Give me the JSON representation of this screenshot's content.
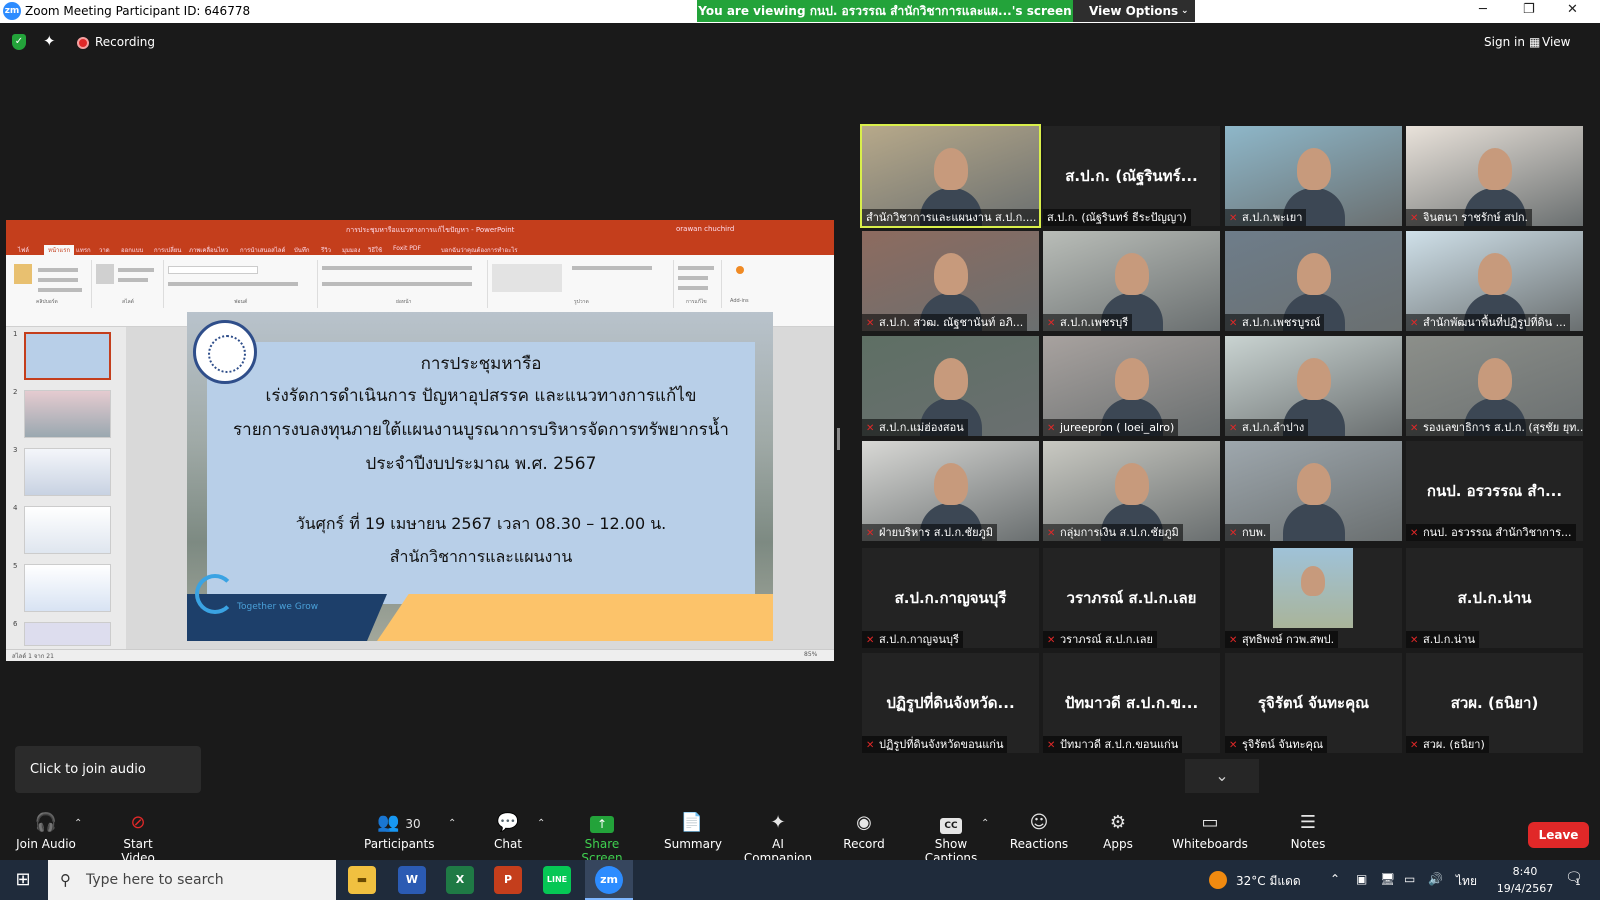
{
  "window": {
    "title": "Zoom Meeting Participant ID: 646778",
    "controls": [
      "─",
      "❐",
      "✕"
    ]
  },
  "share_banner": {
    "text": "You are viewing กนป. อรวรรณ สำนักวิชาการและแผ...'s screen",
    "button": "View Options"
  },
  "top_bar": {
    "recording": "Recording",
    "sign_in": "Sign in",
    "view": "View"
  },
  "shared_screen": {
    "app_title": "การประชุมหารือแนวทางการแก้ไขปัญหา - PowerPoint",
    "user": "orawan chuchird",
    "ribbon_tabs": [
      "ไฟล์",
      "หน้าแรก",
      "แทรก",
      "วาด",
      "ออกแบบ",
      "การเปลี่ยน",
      "ภาพเคลื่อนไหว",
      "การนำเสนอสไลด์",
      "บันทึก",
      "รีวิว",
      "มุมมอง",
      "วิธีใช้",
      "Foxit PDF",
      "บอกฉันว่าคุณต้องการทำอะไร"
    ],
    "ribbon_groups": [
      "คลิปบอร์ด",
      "สไลด์",
      "ฟอนต์",
      "ย่อหน้า",
      "รูปวาด",
      "การแก้ไข",
      "Add-ins"
    ],
    "thumb_numbers": [
      "1",
      "2",
      "3",
      "4",
      "5",
      "6"
    ],
    "slide": {
      "line1": "การประชุมหารือ",
      "line2": "เร่งรัดการดำเนินการ ปัญหาอุปสรรค และแนวทางการแก้ไข",
      "line3": "รายการงบลงทุนภายใต้แผนงานบูรณาการบริหารจัดการทรัพยากรน้ำ",
      "line4": "ประจำปีงบประมาณ พ.ศ. 2567",
      "line5": "วันศุกร์ ที่ 19 เมษายน  2567  เวลา 08.30 – 12.00 น.",
      "line6": "สำนักวิชาการและแผนงาน",
      "slogan": "Together we Grow"
    },
    "status_left": "สไลด์ 1 จาก 21",
    "status_zoom": "85%"
  },
  "gallery": [
    {
      "name": "สำนักวิชาการและแผนงาน ส.ป.ก....",
      "kind": "video",
      "active": true,
      "muted": false,
      "tone": "#b7a98a"
    },
    {
      "name": "ส.ป.ก. (ณัฐรินทร์ ธีระปัญญา)",
      "big": "ส.ป.ก. (ณัฐรินทร์...",
      "kind": "avatar",
      "muted": false
    },
    {
      "name": "ส.ป.ก.พะเยา",
      "kind": "video",
      "muted": true,
      "tone": "#8eb7c9"
    },
    {
      "name": "จินตนา  ราชรักษ์ สปก.",
      "kind": "video",
      "muted": true,
      "tone": "#e9e2da"
    },
    {
      "name": "ส.ป.ก. สวฒ. ณัฐชานันท์ อภิ...",
      "kind": "video",
      "muted": true,
      "tone": "#8d6b5f"
    },
    {
      "name": "ส.ป.ก.เพชรบุรี",
      "kind": "video",
      "muted": true,
      "tone": "#b9bdb8"
    },
    {
      "name": "ส.ป.ก.เพชรบูรณ์",
      "kind": "video",
      "muted": true,
      "tone": "#6e7d8a"
    },
    {
      "name": "สำนักพัฒนาพื้นที่ปฏิรูปที่ดิน ...",
      "kind": "video",
      "muted": true,
      "tone": "#cfe0e9"
    },
    {
      "name": "ส.ป.ก.แม่ฮ่องสอน",
      "kind": "video",
      "muted": true,
      "tone": "#5e6f64"
    },
    {
      "name": "jureepron ( loei_alro)",
      "kind": "video",
      "muted": true,
      "tone": "#a8a29f"
    },
    {
      "name": "ส.ป.ก.ลำปาง",
      "kind": "video",
      "muted": true,
      "tone": "#c9d3d1"
    },
    {
      "name": "รองเลขาธิการ ส.ป.ก. (สุรชัย ยุท...",
      "kind": "video",
      "muted": true,
      "tone": "#8c8f8a"
    },
    {
      "name": "ฝ่ายบริหาร ส.ป.ก.ชัยภูมิ",
      "kind": "video",
      "muted": true,
      "tone": "#d8d8d5"
    },
    {
      "name": "กลุ่มการเงิน ส.ป.ก.ชัยภูมิ",
      "kind": "video",
      "muted": true,
      "tone": "#c9c9c2"
    },
    {
      "name": "กบพ.",
      "kind": "video",
      "muted": true,
      "tone": "#9ea7ad"
    },
    {
      "name": "กนป. อรวรรณ สำนักวิชาการ...",
      "big": "กนป. อรวรรณ สำ...",
      "kind": "avatar",
      "muted": true
    },
    {
      "name": "ส.ป.ก.กาญจนบุรี",
      "big": "ส.ป.ก.กาญจนบุรี",
      "kind": "avatar",
      "muted": true
    },
    {
      "name": "วราภรณ์ ส.ป.ก.เลย",
      "big": "วราภรณ์ ส.ป.ก.เลย",
      "kind": "avatar",
      "muted": true
    },
    {
      "name": "สุทธิพงษ์ กวพ.สพป.",
      "kind": "photo",
      "muted": true
    },
    {
      "name": "ส.ป.ก.น่าน",
      "big": "ส.ป.ก.น่าน",
      "kind": "avatar",
      "muted": true
    },
    {
      "name": "ปฏิรูปที่ดินจังหวัดขอนแก่น",
      "big": "ปฏิรูปที่ดินจังหวัด...",
      "kind": "avatar",
      "muted": true
    },
    {
      "name": "ปัทมาวดี ส.ป.ก.ขอนแก่น",
      "big": "ปัทมาวดี ส.ป.ก.ข...",
      "kind": "avatar",
      "muted": true
    },
    {
      "name": "รุจิรัตน์ จันทะคุณ",
      "big": "รุจิรัตน์ จันทะคุณ",
      "kind": "avatar",
      "muted": true
    },
    {
      "name": "สวผ. (ธนิยา)",
      "big": "สวผ. (ธนิยา)",
      "kind": "avatar",
      "muted": true
    }
  ],
  "tooltip": "Click to join audio",
  "toolbar": {
    "join_audio": "Join Audio",
    "start_video": "Start Video",
    "participants": "Participants",
    "participants_count": "30",
    "chat": "Chat",
    "share_screen": "Share Screen",
    "summary": "Summary",
    "ai_companion": "AI Companion",
    "record": "Record",
    "show_captions": "Show Captions",
    "reactions": "Reactions",
    "apps": "Apps",
    "whiteboards": "Whiteboards",
    "notes": "Notes",
    "leave": "Leave"
  },
  "taskbar": {
    "search_placeholder": "Type here to search",
    "weather": "32°C มีแดด",
    "lang": "ไทย",
    "time": "8:40",
    "date": "19/4/2567",
    "notif_count": "1"
  },
  "colors": {
    "zoom_blue": "#2d8cff",
    "share_green": "#23a33a",
    "leave_red": "#e02828",
    "active_speaker": "#d9ef4a",
    "ppt_red": "#c43e1c"
  }
}
